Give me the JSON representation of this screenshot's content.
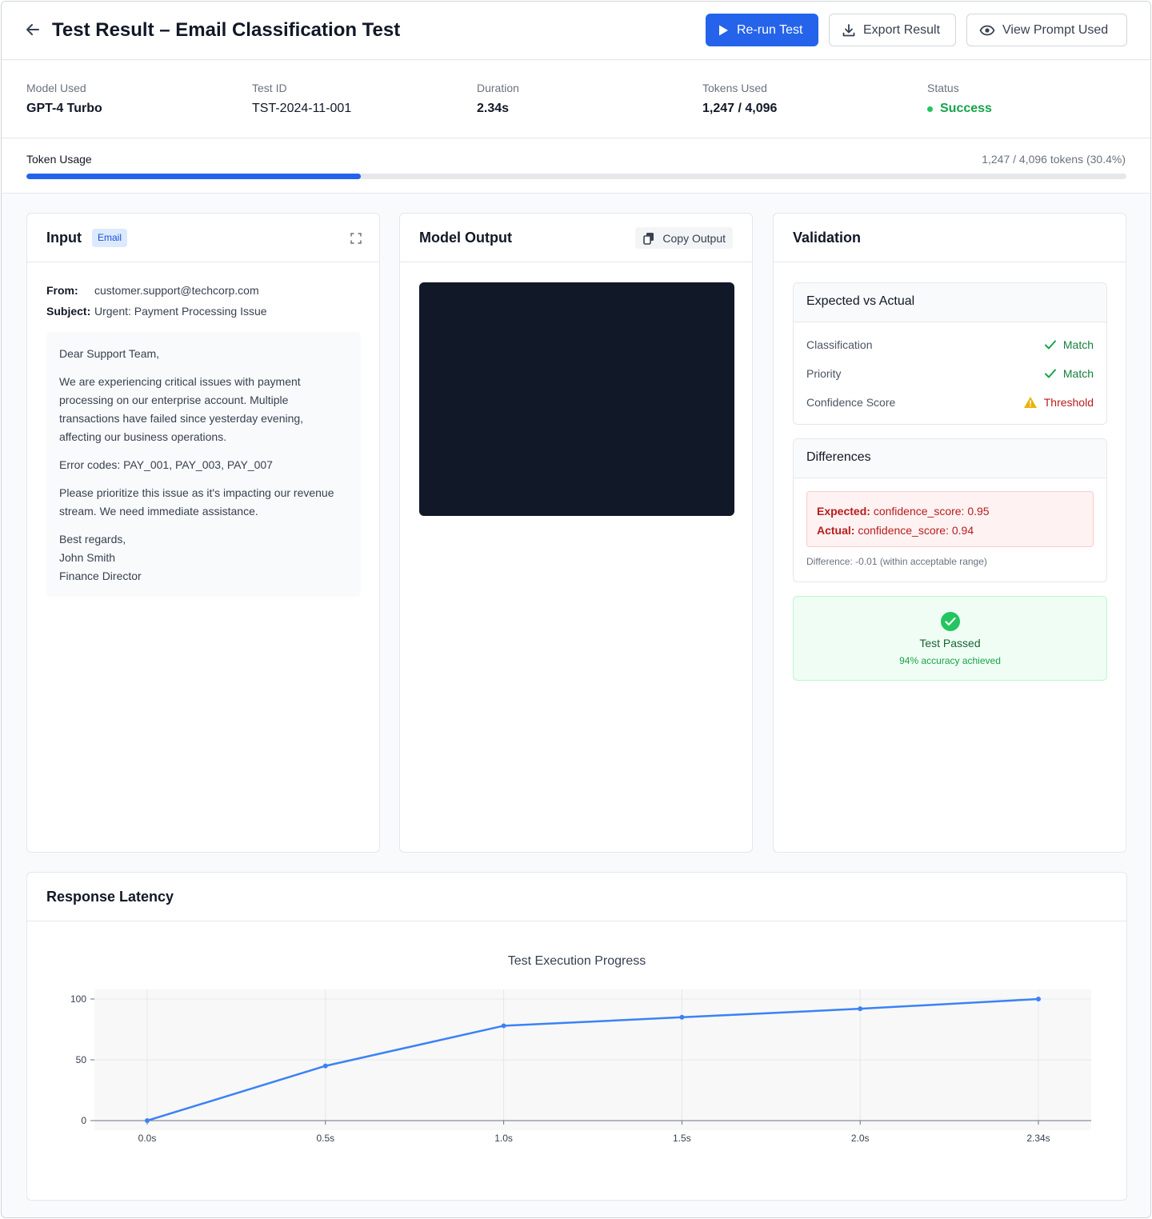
{
  "header": {
    "title": "Test Result – Email Classification Test",
    "rerun_label": "Re-run Test",
    "export_label": "Export Result",
    "view_prompt_label": "View Prompt Used"
  },
  "info": [
    {
      "label": "Model Used",
      "value": "GPT-4 Turbo"
    },
    {
      "label": "Test ID",
      "value": "TST-2024-11-001"
    },
    {
      "label": "Duration",
      "value": "2.34s"
    },
    {
      "label": "Tokens Used",
      "value": "1,247 / 4,096"
    },
    {
      "label": "Status",
      "value": "Success"
    }
  ],
  "usage": {
    "label": "Token Usage",
    "summary": "1,247 / 4,096 tokens (30.4%)",
    "fraction": 0.304
  },
  "input": {
    "title": "Input",
    "badge": "Email",
    "from_label": "From:",
    "from_value": "customer.support@techcorp.com",
    "subject_label": "Subject:",
    "subject_value": "Urgent: Payment Processing Issue",
    "greeting": "Dear Support Team,",
    "para1": "We are experiencing critical issues with payment processing on our enterprise account. Multiple transactions have failed since yesterday evening, affecting our business operations.",
    "para2": "Error codes: PAY_001, PAY_003, PAY_007",
    "para3": "Please prioritize this issue as it's impacting our revenue stream. We need immediate assistance.",
    "signoff": "Best regards,",
    "name": "John Smith",
    "role": "Finance Director"
  },
  "output": {
    "title": "Model Output",
    "copy_label": "Copy Output"
  },
  "validation": {
    "title": "Validation",
    "expected_title": "Expected vs Actual",
    "checks": [
      {
        "label": "Classification",
        "result": "Match",
        "state": "ok"
      },
      {
        "label": "Priority",
        "result": "Match",
        "state": "ok"
      },
      {
        "label": "Confidence Score",
        "result": "Threshold",
        "state": "warn"
      }
    ],
    "diff_title": "Differences",
    "expected_key": "Expected:",
    "expected_value": "confidence_score: 0.95",
    "actual_key": "Actual:",
    "actual_value": "confidence_score: 0.94",
    "diff_note": "Difference: -0.01 (within acceptable range)",
    "passed_title": "Test Passed",
    "passed_sub": "94% accuracy achieved"
  },
  "latency": {
    "title": "Response Latency"
  },
  "colors": {
    "primary": "#2563eb",
    "success": "#16a34a",
    "danger": "#b91c1c",
    "warning": "#eab308",
    "line": "#3b82f6"
  },
  "chart_data": {
    "type": "line",
    "title": "Test Execution Progress",
    "x": [
      0.0,
      0.5,
      1.0,
      1.5,
      2.0,
      2.34
    ],
    "x_tick_labels": [
      "0.0s",
      "0.5s",
      "1.0s",
      "1.5s",
      "2.0s",
      "2.34s"
    ],
    "values": [
      0,
      45,
      78,
      85,
      92,
      100
    ],
    "y_ticks": [
      0,
      50,
      100
    ],
    "ylim": [
      0,
      100
    ],
    "grid": true,
    "xlabel": "",
    "ylabel": ""
  }
}
